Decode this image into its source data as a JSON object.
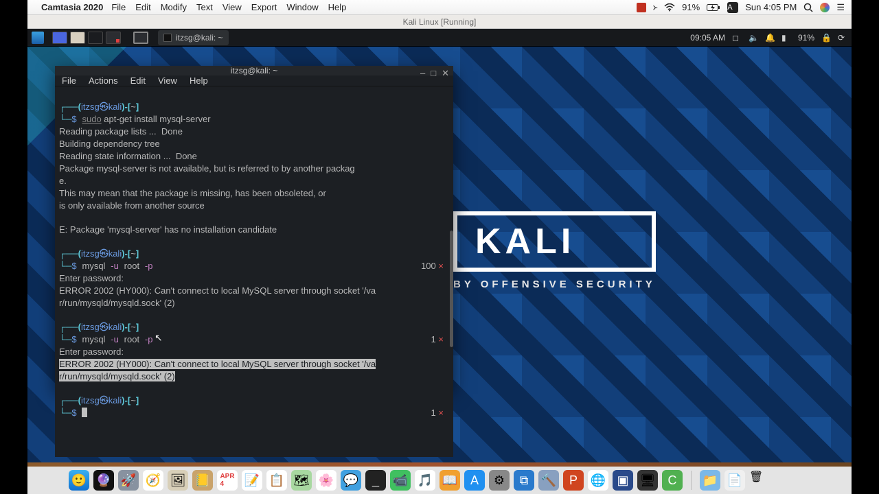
{
  "mac": {
    "app_name": "Camtasia 2020",
    "menu": [
      "File",
      "Edit",
      "Modify",
      "Text",
      "View",
      "Export",
      "Window",
      "Help"
    ],
    "battery": "91%",
    "clock": "Sun 4:05 PM"
  },
  "vm_title": "Kali Linux  [Running]",
  "kali_panel": {
    "task_tab": "itzsg@kali: ~",
    "clock": "09:05 AM",
    "battery": "91%"
  },
  "kali_logo": {
    "title": "KALI",
    "subtitle": "BY OFFENSIVE SECURITY"
  },
  "terminal": {
    "title": "itzsg@kali: ~",
    "menu": [
      "File",
      "Actions",
      "Edit",
      "View",
      "Help"
    ],
    "prompt_user": "itzsg㉿kali",
    "prompt_path": "~",
    "cmd1": {
      "sudo": "sudo",
      "rest": " apt-get install mysql-server"
    },
    "out1_l1": "Reading package lists ...  Done",
    "out1_l2": "Building dependency tree",
    "out1_l3": "Reading state information ...  Done",
    "out1_l4": "Package mysql-server is not available, but is referred to by another packag",
    "out1_l5": "e.",
    "out1_l6": "This may mean that the package is missing, has been obsoleted, or",
    "out1_l7": "is only available from another source",
    "out1_err": "E: Package 'mysql-server' has no installation candidate",
    "cmd2": {
      "bin": "mysql",
      "flag_u": "-u",
      "user": "root",
      "flag_p": "-p"
    },
    "enter_pw": "Enter password:",
    "err2_l1": "ERROR 2002 (HY000): Can't connect to local MySQL server through socket '/va",
    "err2_l2": "r/run/mysqld/mysqld.sock' (2)",
    "count1": "100",
    "count2": "1",
    "count3": "1",
    "x": "×"
  },
  "dock_apps": [
    "finder",
    "siri",
    "launchpad",
    "safari",
    "preview",
    "contacts",
    "calendar",
    "notes",
    "reminders",
    "maps",
    "photos",
    "messages",
    "terminal",
    "facetime",
    "itunes",
    "books",
    "appstore",
    "settings",
    "vscode",
    "xcode",
    "powerpoint",
    "chrome",
    "virtualbox",
    "screenflow",
    "camtasia"
  ]
}
